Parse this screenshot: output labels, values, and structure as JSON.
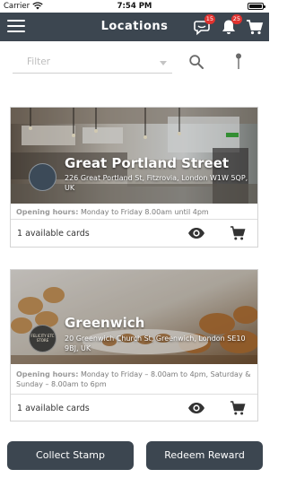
{
  "status_bar": {
    "carrier": "Carrier",
    "time": "7:54 PM"
  },
  "nav": {
    "title": "Locations",
    "notifications_badge": "15",
    "bell_badge": "25"
  },
  "filter": {
    "placeholder": "Filter"
  },
  "locations": [
    {
      "name": "Great Portland Street",
      "address": "226 Great Portland St, Fitzrovia, London W1W 5QP, UK",
      "hours_label": "Opening hours:",
      "hours_text": "Monday to Friday 8.00am until 4pm",
      "cards": "1 available cards"
    },
    {
      "name": "Greenwich",
      "address": "20 Greenwich Church St, Greenwich, London SE10 9BJ, UK",
      "logo_text": "FELICITY ETC STORE",
      "hours_label": "Opening hours:",
      "hours_text": "Monday to Friday – 8.00am to 4pm, Saturday & Sunday – 8.00am to 6pm",
      "cards": "1 available cards"
    }
  ],
  "actions": {
    "collect": "Collect Stamp",
    "redeem": "Redeem Reward"
  },
  "colors": {
    "header": "#3c4650",
    "badge": "#e0322f"
  }
}
